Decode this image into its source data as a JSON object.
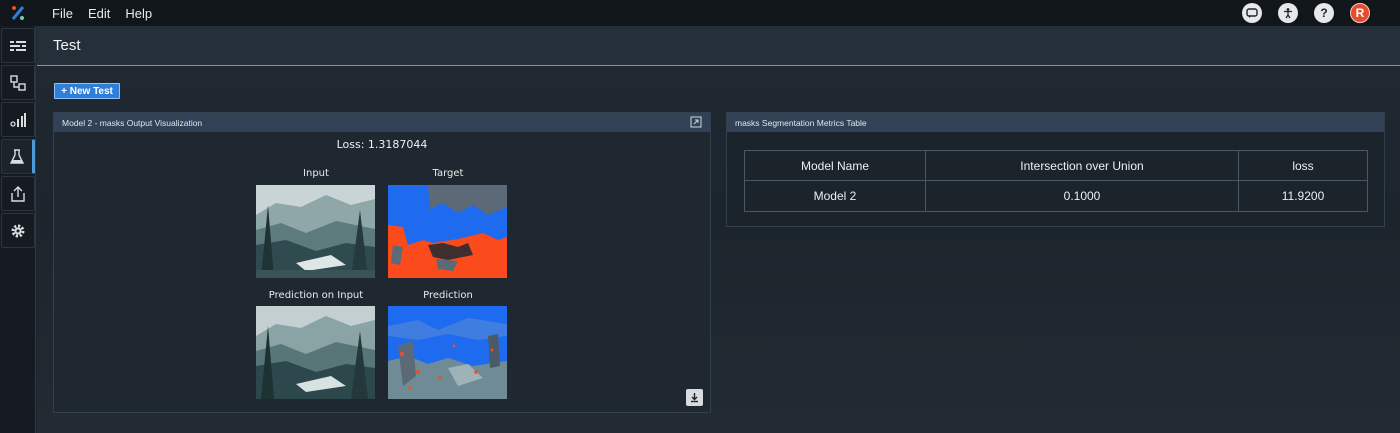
{
  "menu": {
    "items": [
      "File",
      "Edit",
      "Help"
    ]
  },
  "top_icons": [
    "chat-icon",
    "accessibility-icon",
    "help-icon",
    "user-avatar-icon"
  ],
  "avatar_letter": "R",
  "sidebar": {
    "items": [
      "pipeline-icon",
      "model-icon",
      "training-icon",
      "test-icon",
      "export-icon",
      "settings-icon"
    ],
    "active": "test-icon"
  },
  "header": {
    "title": "Test"
  },
  "toolbar": {
    "new_test_label": "+ New Test"
  },
  "viz_panel": {
    "title": "Model 2 - masks Output Visualization",
    "loss_label": "Loss: 1.3187044",
    "images": {
      "input": "Input",
      "target": "Target",
      "prediction_on_input": "Prediction on Input",
      "prediction": "Prediction"
    }
  },
  "metrics_panel": {
    "title": "masks Segmentation Metrics Table",
    "columns": [
      "Model Name",
      "Intersection over Union",
      "loss"
    ],
    "rows": [
      [
        "Model 2",
        "0.1000",
        "11.9200"
      ]
    ]
  },
  "colors": {
    "accent": "#2f7fd8",
    "panel_header": "#314256",
    "header_border": "#5aa9a3",
    "seg_blue": "#1e6bf0",
    "seg_red": "#fb4a1b",
    "seg_gray": "#5c6a78"
  }
}
